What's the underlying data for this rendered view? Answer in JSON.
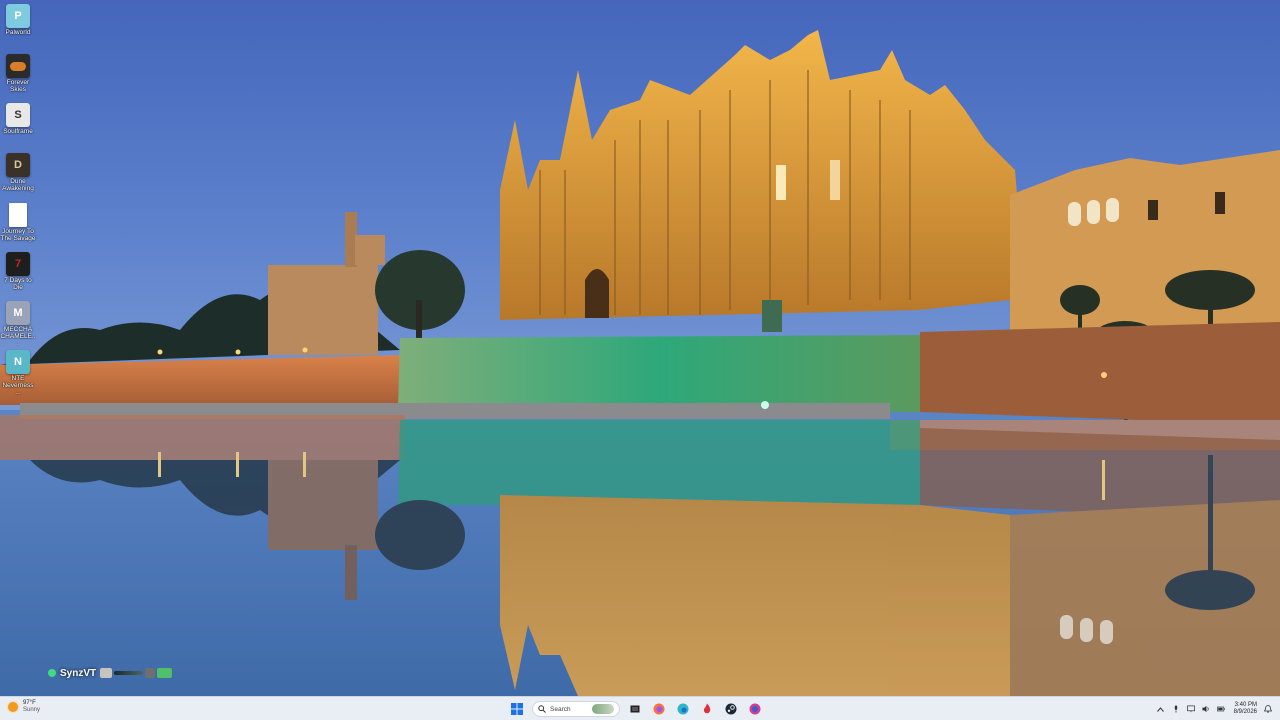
{
  "desktop": {
    "icons": [
      {
        "label": "Palworld",
        "icon": "palworld-icon",
        "color": "#7ecbe0"
      },
      {
        "label": "Forever Skies",
        "icon": "forever-skies-icon",
        "color": "#d97d2a"
      },
      {
        "label": "Soulframe",
        "icon": "soulframe-icon",
        "color": "#e8e8e8"
      },
      {
        "label": "Dune Awakening",
        "icon": "dune-awakening-icon",
        "color": "#6b5a45"
      },
      {
        "label": "Journey To The Savage",
        "icon": "document-icon",
        "color": "#ffffff"
      },
      {
        "label": "7 Days to Die",
        "icon": "7-days-to-die-icon",
        "color": "#8a1b1b"
      },
      {
        "label": "MECCHA CHAMELE...",
        "icon": "meccha-chameleon-icon",
        "color": "#9aa3b8"
      },
      {
        "label": "NTE Neverness ...",
        "icon": "nte-icon",
        "color": "#58b8c8"
      }
    ]
  },
  "overlay": {
    "username": "SynzVT",
    "status_color": "#3ddc84"
  },
  "taskbar": {
    "weather": {
      "temperature": "97°F",
      "condition": "Sunny",
      "icon": "sun-icon"
    },
    "search_placeholder": "Search",
    "pinned": [
      {
        "name": "start-button",
        "icon": "windows-logo-icon"
      },
      {
        "name": "task-view-button",
        "icon": "task-view-icon"
      },
      {
        "name": "firefox-button",
        "icon": "firefox-icon"
      },
      {
        "name": "edge-button",
        "icon": "edge-icon"
      },
      {
        "name": "app-red-button",
        "icon": "flame-icon"
      },
      {
        "name": "steam-button",
        "icon": "steam-icon"
      },
      {
        "name": "app-pink-button",
        "icon": "chat-icon"
      }
    ],
    "tray": {
      "time": "3:40 PM",
      "date": "8/9/2026"
    }
  },
  "colors": {
    "taskbar_bg": "#e9eef5",
    "sky_top": "#4b6bbf",
    "cathedral_gold": "#e8a23a",
    "water": "#4e7ab8",
    "green_light": "#28b07a"
  }
}
